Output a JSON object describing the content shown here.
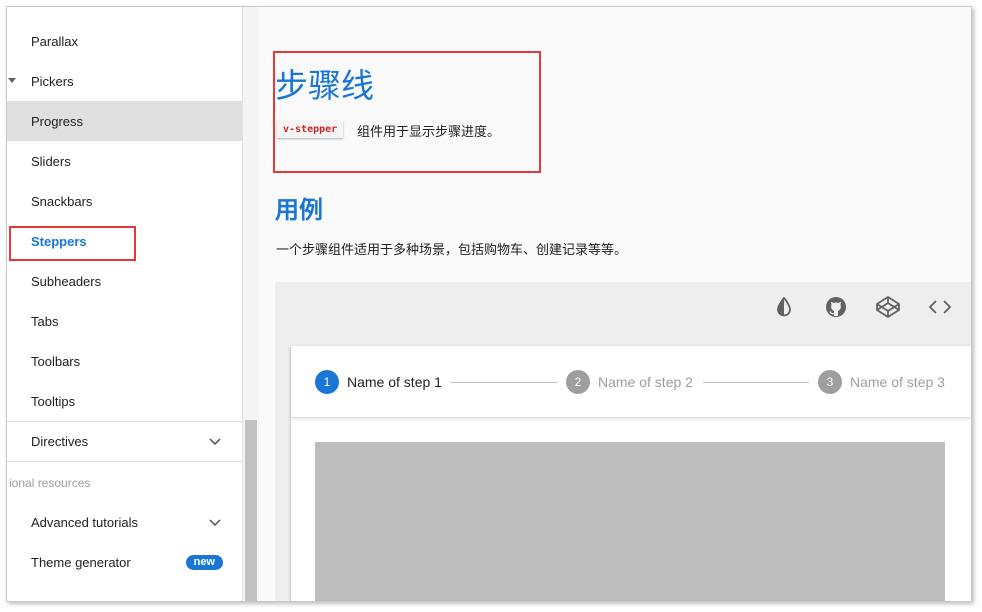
{
  "sidebar": {
    "items": [
      {
        "label": "Parallax"
      },
      {
        "label": "Pickers"
      },
      {
        "label": "Progress"
      },
      {
        "label": "Sliders"
      },
      {
        "label": "Snackbars"
      },
      {
        "label": "Steppers"
      },
      {
        "label": "Subheaders"
      },
      {
        "label": "Tabs"
      },
      {
        "label": "Toolbars"
      },
      {
        "label": "Tooltips"
      },
      {
        "label": "Directives"
      }
    ],
    "subheader": "ional resources",
    "resources": [
      {
        "label": "Advanced tutorials"
      },
      {
        "label": "Theme generator",
        "badge": "new"
      }
    ]
  },
  "main": {
    "title": "步骤线",
    "component_tag": "v-stepper",
    "description": "组件用于显示步骤进度。",
    "usage_title": "用例",
    "usage_description": "一个步骤组件适用于多种场景，包括购物车、创建记录等等。"
  },
  "stepper": {
    "steps": [
      {
        "number": "1",
        "label": "Name of step 1",
        "active": true
      },
      {
        "number": "2",
        "label": "Name of step 2",
        "active": false
      },
      {
        "number": "3",
        "label": "Name of step 3",
        "active": false
      }
    ]
  },
  "toolbar_icons": [
    "invert-colors-icon",
    "github-icon",
    "codepen-icon",
    "code-icon"
  ],
  "colors": {
    "accent": "#1976d2",
    "inactive_step": "#9e9e9e",
    "annotation": "#e53935",
    "code": "#c62828"
  }
}
